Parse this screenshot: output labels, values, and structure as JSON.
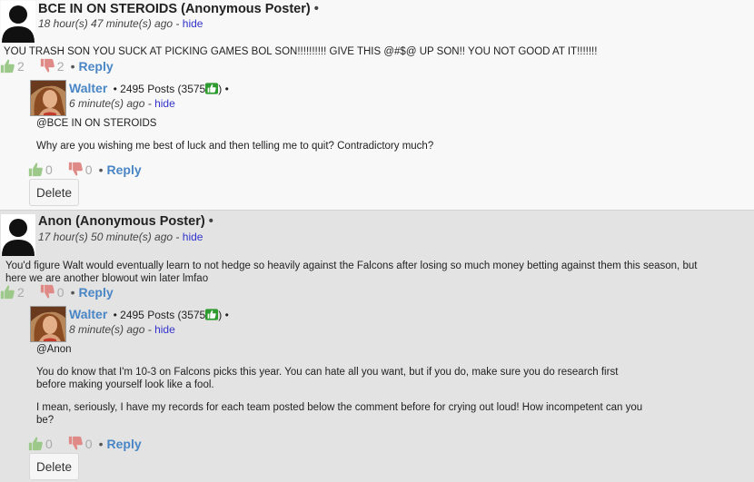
{
  "comment1": {
    "author": "BCE IN ON STEROIDS",
    "poster_tag": "(Anonymous Poster)",
    "bullet": "•",
    "time": "18 hour(s) 47 minute(s) ago",
    "sep": "-",
    "hide": "hide",
    "text": "YOU TRASH SON YOU SUCK AT PICKING GAMES BOL SON!!!!!!!!!! GIVE THIS @#$@ UP SON!! YOU NOT GOOD AT IT!!!!!!!",
    "up": "2",
    "down": "2",
    "reply": "Reply",
    "reply_bullet": "•"
  },
  "reply1": {
    "author": "Walter",
    "stats": "• 2495 Posts (3575",
    "stats_end": ") •",
    "time": "6 minute(s) ago",
    "sep": "-",
    "hide": "hide",
    "mention": "@BCE IN ON STEROIDS",
    "text": "Why are you wishing me best of luck and then telling me to quit? Contradictory much?",
    "up": "0",
    "down": "0",
    "reply": "Reply",
    "reply_bullet": "•",
    "delete": "Delete"
  },
  "comment2": {
    "author": "Anon",
    "poster_tag": "(Anonymous Poster)",
    "bullet": "•",
    "time": "17 hour(s) 50 minute(s) ago",
    "sep": "-",
    "hide": "hide",
    "text_line1": "You'd figure Walt would eventually learn to not hedge so heavily against the Falcons after losing so much money betting against them this season, but",
    "text_line2": "here we are another blowout win later lmfao",
    "up": "2",
    "down": "0",
    "reply": "Reply",
    "reply_bullet": "•"
  },
  "reply2": {
    "author": "Walter",
    "stats": "• 2495 Posts (3575",
    "stats_end": ") •",
    "time": "8 minute(s) ago",
    "sep": "-",
    "hide": "hide",
    "mention": "@Anon",
    "para1_line1": "You do know that I'm 10-3 on Falcons picks this year. You can hate all you want, but if you do, make sure you do research first",
    "para1_line2": "before making yourself look like a fool.",
    "para2_line1": "I mean, seriously, I have my records for each team posted below the comment before for crying out loud! How incompetent can you",
    "para2_line2": "be?",
    "up": "0",
    "down": "0",
    "reply": "Reply",
    "reply_bullet": "•",
    "delete": "Delete"
  },
  "icons": {
    "avatar_anon": "anonymous-silhouette",
    "thumb_up": "thumbs-up",
    "thumb_down": "thumbs-down"
  },
  "colors": {
    "link": "#4a86c5",
    "hide_link": "#3333cc",
    "thumb_up": "#9cc98a",
    "thumb_down": "#e08a88",
    "thread_a_bg": "#f8f8f8",
    "thread_b_bg": "#e3e3e3"
  }
}
